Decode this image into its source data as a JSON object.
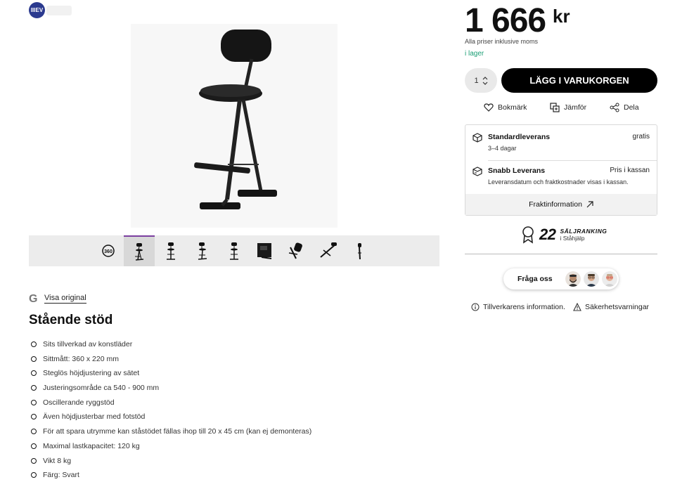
{
  "brand": {
    "logo_text": "IIIEV"
  },
  "gallery": {
    "thumbs": [
      {
        "name": "thumb-360",
        "icon": "360-icon"
      },
      {
        "name": "thumb-1",
        "icon": "stool-icon"
      },
      {
        "name": "thumb-2",
        "icon": "stool-icon"
      },
      {
        "name": "thumb-3",
        "icon": "stool-icon"
      },
      {
        "name": "thumb-4",
        "icon": "stool-icon"
      },
      {
        "name": "thumb-5",
        "icon": "stool-icon"
      },
      {
        "name": "thumb-6",
        "icon": "stool-icon"
      },
      {
        "name": "thumb-7",
        "icon": "stool-icon"
      },
      {
        "name": "thumb-8",
        "icon": "stool-icon"
      }
    ]
  },
  "translate": {
    "visa_original": "Visa original"
  },
  "product": {
    "title": "Stående stöd",
    "features": [
      "Sits tillverkad av konstläder",
      "Sittmått: 360 x 220 mm",
      "Steglös höjdjustering av sätet",
      "Justeringsområde ca 540 - 900 mm",
      "Oscillerande ryggstöd",
      "Även höjdjusterbar med fotstöd",
      "För att spara utrymme kan ståstödet fällas ihop till 20 x 45 cm (kan ej demonteras)",
      "Maximal lastkapacitet: 120 kg",
      "Vikt 8 kg",
      "Färg: Svart"
    ]
  },
  "pricing": {
    "price": "1 666",
    "currency": "kr",
    "note": "Alla priser inklusive moms",
    "stock": "i lager"
  },
  "cart": {
    "quantity": "1",
    "add_label": "LÄGG I VARUKORGEN"
  },
  "actions": {
    "bookmark": "Bokmärk",
    "compare": "Jämför",
    "share": "Dela"
  },
  "delivery": {
    "standard_title": "Standardleverans",
    "standard_sub": "3–4 dagar",
    "standard_price": "gratis",
    "fast_title": "Snabb Leverans",
    "fast_sub": "Leveransdatum och fraktkostnader visas i kassan.",
    "fast_price": "Pris i kassan",
    "info_label": "Fraktinformation"
  },
  "ranking": {
    "number": "22",
    "title": "SÄLJRANKING",
    "sub": "i Ståhjälp"
  },
  "ask": {
    "label": "Fråga oss"
  },
  "links": {
    "manufacturer": "Tillverkarens information.",
    "safety": "Säkerhetsvarningar"
  },
  "colors": {
    "stock_green": "#1a9e74",
    "accent_purple": "#7b3fa0",
    "button_black": "#000000"
  }
}
